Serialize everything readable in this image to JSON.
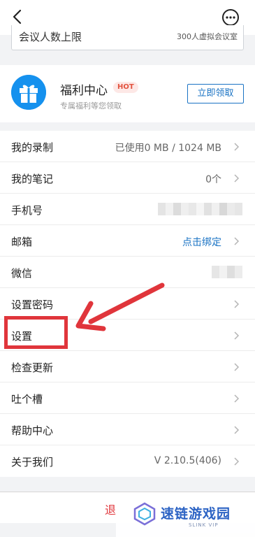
{
  "meeting": {
    "label": "会议人数上限",
    "value": "300人虚拟会议室"
  },
  "welfare": {
    "title": "福利中心",
    "badge": "HOT",
    "subtitle": "专属福利等您领取",
    "button": "立即领取"
  },
  "menu": {
    "items": [
      {
        "label": "我的录制",
        "value": "已使用0 MB / 1024 MB"
      },
      {
        "label": "我的笔记",
        "value": "0个"
      },
      {
        "label": "手机号",
        "value": ""
      },
      {
        "label": "邮箱",
        "value": "点击绑定"
      },
      {
        "label": "微信",
        "value": ""
      },
      {
        "label": "设置密码",
        "value": ""
      },
      {
        "label": "设置",
        "value": ""
      },
      {
        "label": "检查更新",
        "value": ""
      },
      {
        "label": "吐个槽",
        "value": ""
      },
      {
        "label": "帮助中心",
        "value": ""
      },
      {
        "label": "关于我们",
        "value": "V 2.10.5(406)"
      }
    ]
  },
  "logout": {
    "label": "退"
  },
  "watermark": {
    "text": "速链游戏园",
    "sub": "SLINK VIP"
  },
  "colors": {
    "accent": "#1a73c4",
    "danger": "#e0353b",
    "gift": "#1591ee"
  }
}
